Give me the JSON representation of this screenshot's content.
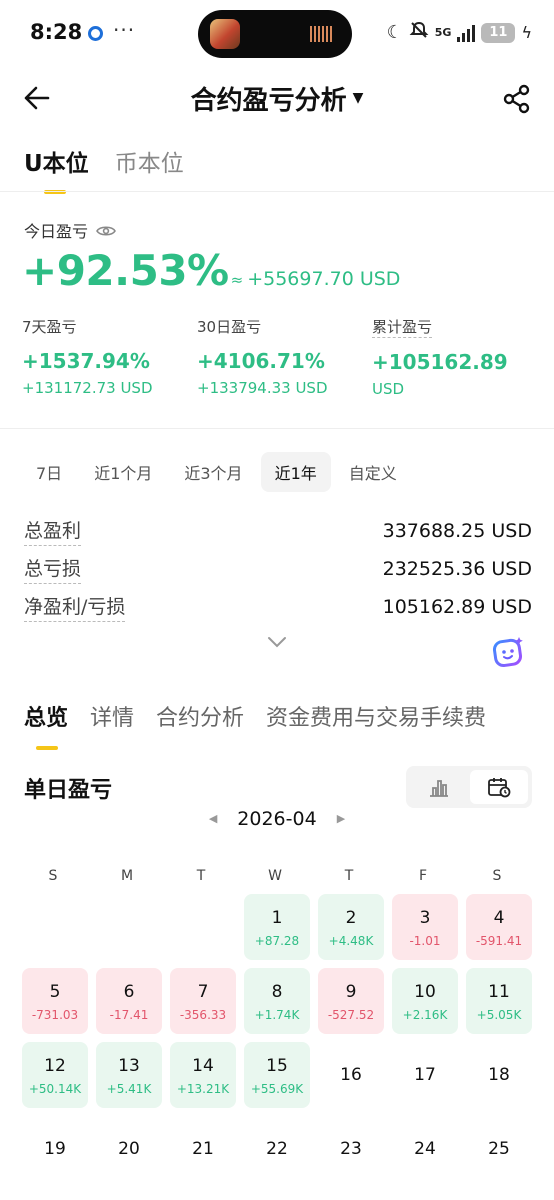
{
  "status": {
    "time": "8:28",
    "more": "···",
    "net": "5G",
    "battery": "11"
  },
  "nav": {
    "title": "合约盈亏分析"
  },
  "unit_tabs": [
    "U本位",
    "币本位"
  ],
  "today": {
    "label": "今日盈亏",
    "pct": "+92.53%",
    "approx": "≈",
    "usd": "+55697.70 USD"
  },
  "stats": [
    {
      "label": "7天盈亏",
      "pct": "+1537.94%",
      "usd": "+131172.73 USD"
    },
    {
      "label": "30日盈亏",
      "pct": "+4106.71%",
      "usd": "+133794.33 USD"
    },
    {
      "label": "累计盈亏",
      "pct": "+105162.89",
      "usd": "USD"
    }
  ],
  "ranges": [
    "7日",
    "近1个月",
    "近3个月",
    "近1年",
    "自定义"
  ],
  "active_range": "近1年",
  "summary": [
    {
      "key": "总盈利",
      "value": "337688.25 USD"
    },
    {
      "key": "总亏损",
      "value": "232525.36 USD"
    },
    {
      "key": "净盈利/亏损",
      "value": "105162.89 USD"
    }
  ],
  "section_tabs": [
    "总览",
    "详情",
    "合约分析",
    "资金费用与交易手续费"
  ],
  "daily": {
    "title": "单日盈亏",
    "month": "2026-04",
    "weekdays": [
      "S",
      "M",
      "T",
      "W",
      "T",
      "F",
      "S"
    ],
    "days": [
      {
        "day": "1",
        "value": "+87.28",
        "sign": "pos"
      },
      {
        "day": "2",
        "value": "+4.48K",
        "sign": "pos"
      },
      {
        "day": "3",
        "value": "-1.01",
        "sign": "neg"
      },
      {
        "day": "4",
        "value": "-591.41",
        "sign": "neg"
      },
      {
        "day": "5",
        "value": "-731.03",
        "sign": "neg"
      },
      {
        "day": "6",
        "value": "-17.41",
        "sign": "neg"
      },
      {
        "day": "7",
        "value": "-356.33",
        "sign": "neg"
      },
      {
        "day": "8",
        "value": "+1.74K",
        "sign": "pos"
      },
      {
        "day": "9",
        "value": "-527.52",
        "sign": "neg"
      },
      {
        "day": "10",
        "value": "+2.16K",
        "sign": "pos"
      },
      {
        "day": "11",
        "value": "+5.05K",
        "sign": "pos"
      },
      {
        "day": "12",
        "value": "+50.14K",
        "sign": "pos"
      },
      {
        "day": "13",
        "value": "+5.41K",
        "sign": "pos"
      },
      {
        "day": "14",
        "value": "+13.21K",
        "sign": "pos"
      },
      {
        "day": "15",
        "value": "+55.69K",
        "sign": "pos"
      },
      {
        "day": "16",
        "value": "",
        "sign": "none"
      },
      {
        "day": "17",
        "value": "",
        "sign": "none"
      },
      {
        "day": "18",
        "value": "",
        "sign": "none"
      },
      {
        "day": "19",
        "value": "",
        "sign": "none"
      },
      {
        "day": "20",
        "value": "",
        "sign": "none"
      },
      {
        "day": "21",
        "value": "",
        "sign": "none"
      },
      {
        "day": "22",
        "value": "",
        "sign": "none"
      },
      {
        "day": "23",
        "value": "",
        "sign": "none"
      },
      {
        "day": "24",
        "value": "",
        "sign": "none"
      },
      {
        "day": "25",
        "value": "",
        "sign": "none"
      }
    ]
  },
  "colors": {
    "positive": "#2ebd85",
    "negative": "#e2556b",
    "accent": "#f5c518"
  }
}
